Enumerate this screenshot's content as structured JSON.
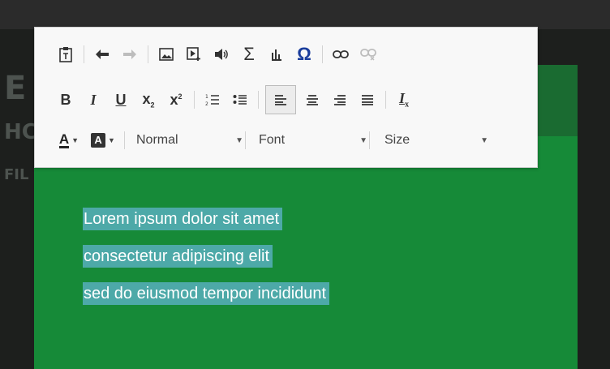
{
  "toolbar": {
    "format_label": "Normal",
    "font_label": "Font",
    "size_label": "Size",
    "text_color_letter": "A",
    "bg_color_letter": "A"
  },
  "content": {
    "lines": [
      "Lorem ipsum dolor sit amet",
      "consectetur adipiscing elit",
      "sed do eiusmod tempor incididunt"
    ]
  },
  "colors": {
    "highlight": "#4da9a8",
    "editor_bg": "#168a38",
    "header_bg": "#1a6b31",
    "special_char": "#1a3d9c"
  }
}
